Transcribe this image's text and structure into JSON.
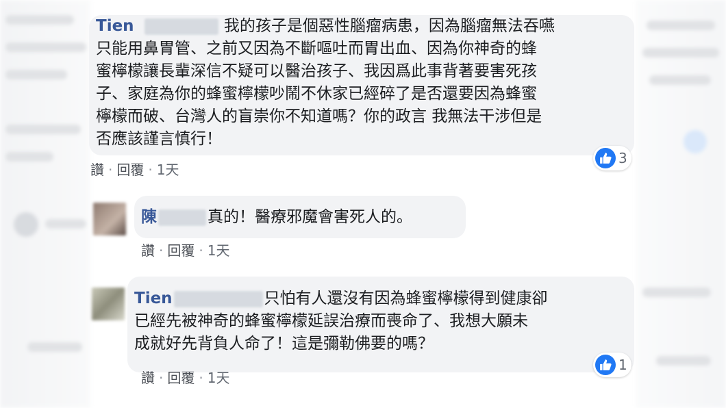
{
  "colors": {
    "name_link": "#385898",
    "bubble_bg": "#f2f3f5",
    "like_blue": "#2078f4"
  },
  "actions": {
    "like": "讚",
    "reply": "回覆",
    "time": "1天",
    "dot": "·"
  },
  "comments": [
    {
      "author": "Tien",
      "text_lines": [
        "我的孩子是個惡性腦瘤病患，因為腦瘤無法吞嚥",
        "只能用鼻胃管、之前又因為不斷嘔吐而胃出血、因為你神奇的蜂",
        "蜜檸檬讓長輩深信不疑可以醫治孩子、我因爲此事背著要害死孩",
        "子、家庭為你的蜂蜜檸檬吵鬧不休家已經碎了是否還要因為蜂蜜",
        "檸檬而破、台灣人的盲崇你不知道嗎？你的政言 我無法干涉但是",
        "否應該謹言慎行！"
      ],
      "reaction_count": "3",
      "reaction_icon": "like-icon"
    },
    {
      "author": "陳",
      "text_lines": [
        "真的！醫療邪魔會害死人的。"
      ]
    },
    {
      "author": "Tien",
      "text_lines": [
        "只怕有人還沒有因為蜂蜜檸檬得到健康卻",
        "已經先被神奇的蜂蜜檸檬延誤治療而喪命了、我想大願未",
        "成就好先背負人命了！這是彌勒佛要的嗎？"
      ],
      "reaction_count": "1",
      "reaction_icon": "like-icon"
    }
  ]
}
